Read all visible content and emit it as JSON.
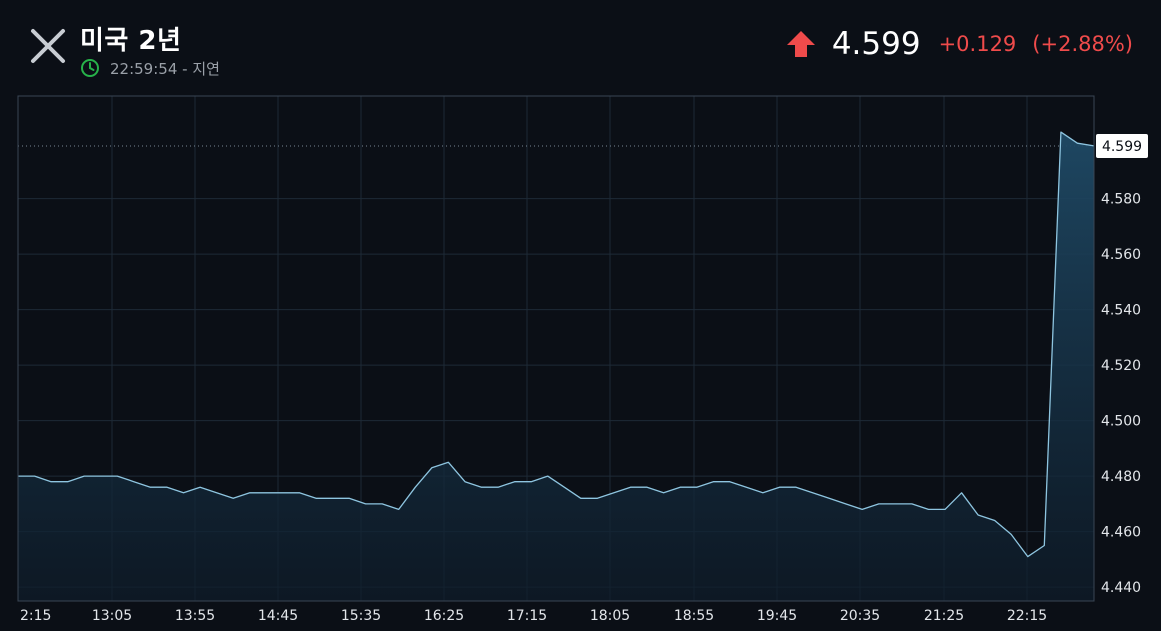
{
  "header": {
    "title": "미국 2년",
    "time_text": "22:59:54 - 지연",
    "close_icon": "close-icon",
    "clock_icon": "clock-icon",
    "clock_color": "#27b24a"
  },
  "quote": {
    "direction_icon": "arrow-up-icon",
    "price": "4.599",
    "change": "+0.129",
    "change_pct": "(+2.88%)",
    "color": "#ef4b4b"
  },
  "chart_data": {
    "type": "area",
    "x_ticks": [
      "2:15",
      "13:05",
      "13:55",
      "14:45",
      "15:35",
      "16:25",
      "17:15",
      "18:05",
      "18:55",
      "19:45",
      "20:35",
      "21:25",
      "22:15"
    ],
    "y_ticks": [
      4.44,
      4.46,
      4.48,
      4.5,
      4.52,
      4.54,
      4.56,
      4.58
    ],
    "ylim": [
      4.435,
      4.617
    ],
    "x": [
      "2:15",
      "",
      "",
      "13:05",
      "",
      "",
      "13:55",
      "",
      "",
      "",
      "14:45",
      "",
      "",
      "",
      "15:35",
      "",
      "",
      "",
      "16:25",
      "",
      "",
      "",
      "17:15",
      "",
      "",
      "",
      "18:05",
      "",
      "",
      "",
      "18:55",
      "",
      "",
      "",
      "19:45",
      "",
      "",
      "",
      "20:35",
      "",
      "",
      "",
      "21:25",
      "",
      "",
      "",
      "22:15",
      "",
      "",
      "",
      "",
      ""
    ],
    "values": [
      4.48,
      4.48,
      4.478,
      4.478,
      4.48,
      4.48,
      4.48,
      4.478,
      4.476,
      4.476,
      4.474,
      4.476,
      4.474,
      4.472,
      4.474,
      4.474,
      4.474,
      4.474,
      4.472,
      4.472,
      4.472,
      4.47,
      4.47,
      4.468,
      4.476,
      4.483,
      4.485,
      4.478,
      4.476,
      4.476,
      4.478,
      4.478,
      4.48,
      4.476,
      4.472,
      4.472,
      4.474,
      4.476,
      4.476,
      4.474,
      4.476,
      4.476,
      4.478,
      4.478,
      4.476,
      4.474,
      4.476,
      4.476,
      4.474,
      4.472,
      4.47,
      4.468,
      4.47,
      4.47,
      4.47,
      4.468,
      4.468,
      4.474,
      4.466,
      4.464,
      4.459,
      4.451,
      4.455,
      4.604,
      4.6,
      4.599
    ],
    "last_value_label": "4.599",
    "last_value": 4.599,
    "line_color": "#8ec5e0",
    "fill_color": "#1f4a66",
    "grid": true
  }
}
